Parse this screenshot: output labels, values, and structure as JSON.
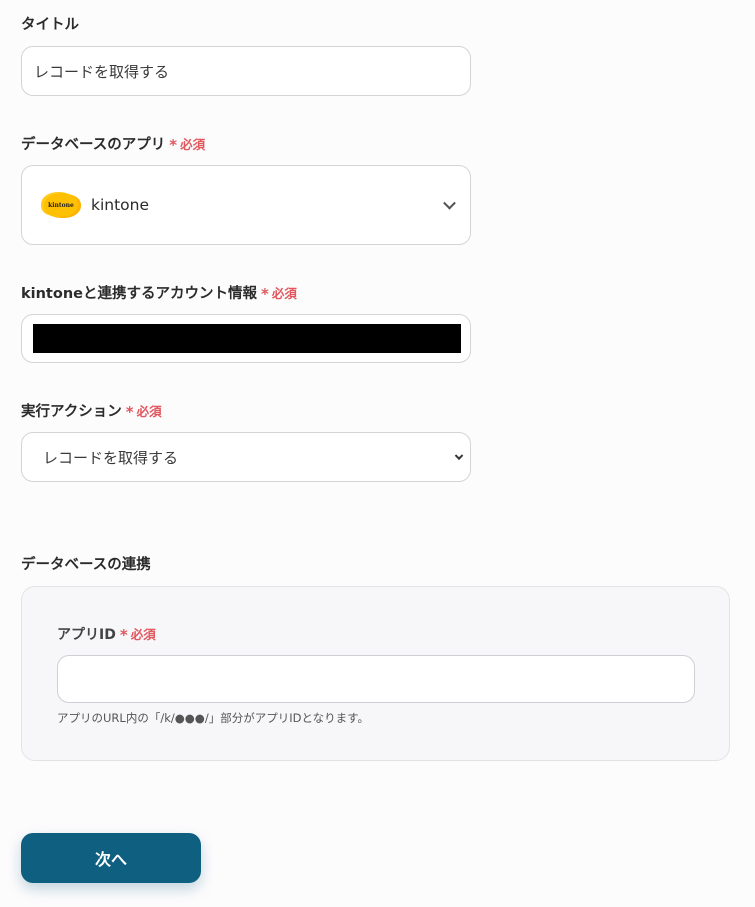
{
  "form": {
    "title": {
      "label": "タイトル",
      "value": "レコードを取得する"
    },
    "database_app": {
      "label": "データベースのアプリ",
      "required_label": "必須",
      "required_mark": "*",
      "selected_app": "kintone",
      "logo_text": "kintone",
      "logo_color": "#ffc000"
    },
    "account": {
      "label": "kintoneと連携するアカウント情報",
      "required_label": "必須",
      "required_mark": "*"
    },
    "action": {
      "label": "実行アクション",
      "required_label": "必須",
      "required_mark": "*",
      "selected": "レコードを取得する"
    },
    "database_link": {
      "section_title": "データベースの連携",
      "app_id": {
        "label": "アプリID",
        "required_label": "必須",
        "required_mark": "*",
        "value": "",
        "help_text": "アプリのURL内の「/k/●●●/」部分がアプリIDとなります。"
      }
    }
  },
  "next_button": {
    "label": "次へ",
    "color": "#0f5f80"
  },
  "colors": {
    "required": "#e0575e",
    "background": "#fdfcfd",
    "panel": "#f7f6f9"
  }
}
